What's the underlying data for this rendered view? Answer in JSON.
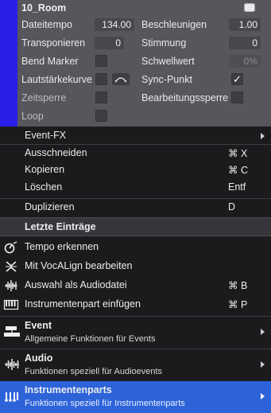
{
  "inspector": {
    "title": "10_Room",
    "rows": {
      "dateitempo_label": "Dateitempo",
      "dateitempo_value": "134.00",
      "beschleunigen_label": "Beschleunigen",
      "beschleunigen_value": "1.00",
      "transponieren_label": "Transponieren",
      "transponieren_value": "0",
      "stimmung_label": "Stimmung",
      "stimmung_value": "0",
      "bend_marker_label": "Bend Marker",
      "schwellwert_label": "Schwellwert",
      "schwellwert_value": "0%",
      "lautstaerkekurve_label": "Lautstärkekurve",
      "sync_punkt_label": "Sync-Punkt",
      "sync_punkt_checked": "✓",
      "zeitsperre_label": "Zeitsperre",
      "bearbeitungssperre_label": "Bearbeitungssperre",
      "loop_label": "Loop"
    }
  },
  "menu": {
    "items": [
      {
        "label": "Event-FX",
        "submenu": true
      },
      {
        "label": "Ausschneiden",
        "shortcut": "⌘ X"
      },
      {
        "label": "Kopieren",
        "shortcut": "⌘ C"
      },
      {
        "label": "Löschen",
        "shortcut": "Entf"
      },
      {
        "label": "Duplizieren",
        "shortcut": "D"
      }
    ],
    "recent_header": "Letzte Einträge",
    "recent": [
      {
        "label": "Tempo erkennen",
        "icon": "tempo-detect-icon"
      },
      {
        "label": "Mit VocALign bearbeiten",
        "icon": "vocalign-icon"
      },
      {
        "label": "Auswahl als Audiodatei",
        "shortcut": "⌘ B",
        "icon": "audio-waveform-icon"
      },
      {
        "label": "Instrumentenpart einfügen",
        "shortcut": "⌘ P",
        "icon": "piano-keys-icon"
      }
    ],
    "categories": [
      {
        "title": "Event",
        "subtitle": "Allgemeine Funktionen für Events",
        "icon": "event-blocks-icon"
      },
      {
        "title": "Audio",
        "subtitle": "Funktionen speziell für Audioevents",
        "icon": "audio-waveform-icon"
      },
      {
        "title": "Instrumentenparts",
        "subtitle": "Funktionen speziell für Instrumentenparts",
        "icon": "instrument-notes-icon",
        "selected": true
      }
    ]
  },
  "colors": {
    "inspector_bg": "#56565c",
    "track_color": "#2b1ee6",
    "menu_bg": "#1b1b1e",
    "selection": "#2c63d8"
  }
}
